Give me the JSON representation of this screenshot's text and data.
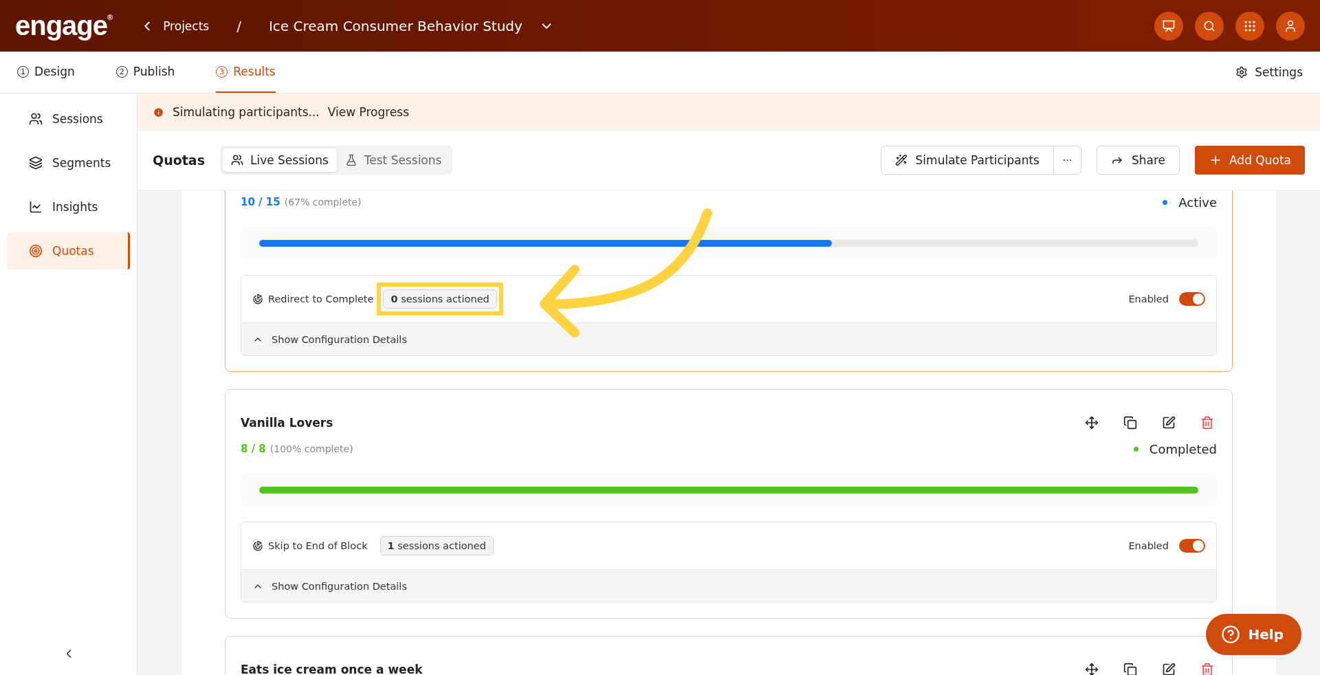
{
  "header": {
    "logo": "engage",
    "logo_mark": "®",
    "back_label": "Projects",
    "separator": "/",
    "project_title": "Ice Cream Consumer Behavior Study"
  },
  "steps": [
    {
      "number": "1",
      "label": "Design",
      "selected": false
    },
    {
      "number": "2",
      "label": "Publish",
      "selected": false
    },
    {
      "number": "3",
      "label": "Results",
      "selected": true
    }
  ],
  "settings_label": "Settings",
  "sidebar": {
    "items": [
      {
        "label": "Sessions",
        "selected": false
      },
      {
        "label": "Segments",
        "selected": false
      },
      {
        "label": "Insights",
        "selected": false
      },
      {
        "label": "Quotas",
        "selected": true
      }
    ]
  },
  "banner": {
    "text": "Simulating participants...",
    "link": "View Progress"
  },
  "toolbar": {
    "title": "Quotas",
    "segments": [
      {
        "label": "Live Sessions",
        "selected": true
      },
      {
        "label": "Test Sessions",
        "selected": false
      }
    ],
    "simulate": "Simulate Participants",
    "more": "···",
    "share": "Share",
    "add": "Add Quota"
  },
  "quotas": [
    {
      "count": "10 / 15",
      "percent": "(67% complete)",
      "status": "Active",
      "color": "#1677ff",
      "level": 0.61,
      "highlighted": true,
      "rule": {
        "label": "Redirect to Complete",
        "sessions": "**0** sessions actioned",
        "toggle_label": "Enabled",
        "on": true
      },
      "details": "Show Configuration Details"
    },
    {
      "title": "Vanilla Lovers",
      "count": "8 / 8",
      "percent": "(100% complete)",
      "status": "Completed",
      "color": "#52c41a",
      "level": 1,
      "highlighted": false,
      "rule": {
        "label": "Skip to End of Block",
        "sessions": "**1** sessions actioned",
        "toggle_label": "Enabled",
        "on": true
      },
      "details": "Show Configuration Details"
    },
    {
      "title": "Eats ice cream once a week"
    }
  ],
  "help": "Help"
}
